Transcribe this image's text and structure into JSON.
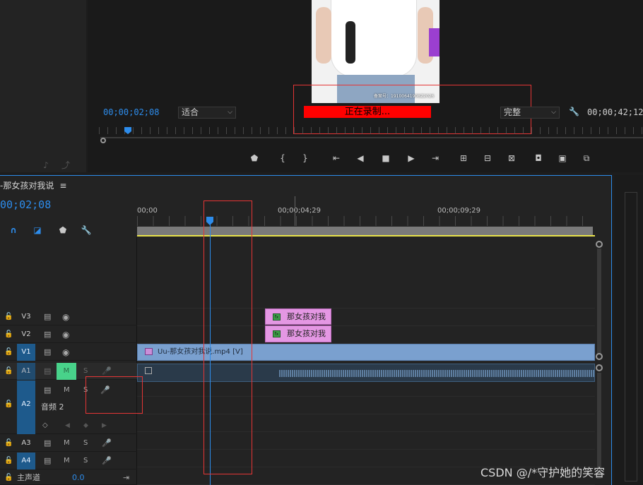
{
  "monitor": {
    "left_icons": [
      "insert-audio-icon",
      "export-frame-icon"
    ],
    "timecode_current": "00;00;02;08",
    "fit_label": "适合",
    "quality_label": "完整",
    "timecode_duration": "00;00;42;12",
    "recording_label": "正在录制...",
    "video_caption": "备案号：19100641908Z2026",
    "playhead_percent": 5.4,
    "controls": [
      "add-marker-icon",
      "mark-in-icon",
      "mark-out-icon",
      "go-to-in-icon",
      "step-back-icon",
      "stop-icon",
      "step-forward-icon",
      "go-to-out-icon",
      "insert-icon",
      "overwrite-icon",
      "compare-icon",
      "export-frame-icon",
      "button-editor-icon",
      "vr-icon"
    ]
  },
  "timeline": {
    "sequence_name": "-那女孩对我说",
    "menu_glyph": "≡",
    "timecode": "00;02;08",
    "ruler": [
      "00;00",
      "00;00;04;29",
      "00;00;09;29"
    ],
    "tools": [
      "snap-icon",
      "linked-selection-icon",
      "add-marker-icon",
      "wrench-icon"
    ],
    "tracks": [
      {
        "name": "V3",
        "type": "video"
      },
      {
        "name": "V2",
        "type": "video"
      },
      {
        "name": "V1",
        "type": "video",
        "targeted": true
      },
      {
        "name": "A1",
        "type": "audio",
        "m_on": true,
        "m": "M",
        "s": "S"
      },
      {
        "name": "A2",
        "type": "audio",
        "targeted": true,
        "m": "M",
        "s": "S",
        "label": "音频 2"
      },
      {
        "name": "A3",
        "type": "audio",
        "m": "M",
        "s": "S"
      },
      {
        "name": "A4",
        "type": "audio",
        "targeted": true,
        "m": "M",
        "s": "S"
      }
    ],
    "master_label": "主声道",
    "master_value": "0.0",
    "clips": {
      "v3": "那女孩对我",
      "v2": "那女孩对我",
      "v1": "Uu-那女孩对我说.mp4 [V]"
    }
  },
  "watermark": "CSDN @/*守护她的笑容",
  "colors": {
    "accent": "#2d8ceb",
    "recording": "#ff0000",
    "highlight": "#e53535",
    "clip_pink": "#e497e3",
    "clip_video": "#7aa0cf",
    "audio_clip": "#3e5e7e",
    "mute_on": "#48d28a"
  }
}
